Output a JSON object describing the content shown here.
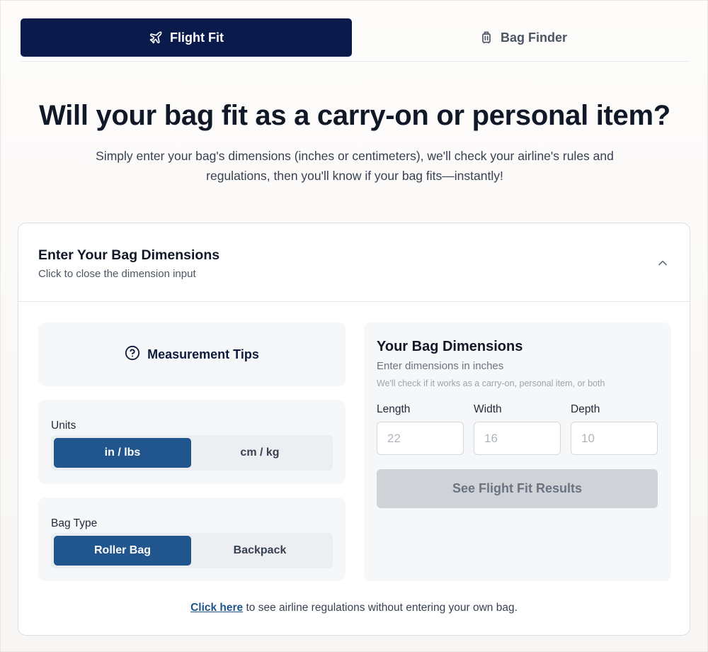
{
  "tabs": [
    {
      "label": "Flight Fit",
      "icon": "plane-icon",
      "active": true
    },
    {
      "label": "Bag Finder",
      "icon": "luggage-icon",
      "active": false
    }
  ],
  "hero": {
    "title": "Will your bag fit as a carry-on or personal item?",
    "subtitle": "Simply enter your bag's dimensions (inches or centimeters), we'll check your airline's rules and regulations, then you'll know if your bag fits—instantly!"
  },
  "card": {
    "title": "Enter Your Bag Dimensions",
    "subtitle": "Click to close the dimension input",
    "collapse_icon": "chevron-up-icon"
  },
  "tips": {
    "label": "Measurement Tips",
    "icon": "question-circle-icon"
  },
  "units": {
    "label": "Units",
    "options": [
      "in / lbs",
      "cm / kg"
    ],
    "selected": "in / lbs"
  },
  "bag_type": {
    "label": "Bag Type",
    "options": [
      "Roller Bag",
      "Backpack"
    ],
    "selected": "Roller Bag"
  },
  "dimensions": {
    "title": "Your Bag Dimensions",
    "subtitle": "Enter dimensions in inches",
    "note": "We'll check if it works as a carry-on, personal item, or both",
    "fields": [
      {
        "label": "Length",
        "placeholder": "22",
        "value": ""
      },
      {
        "label": "Width",
        "placeholder": "16",
        "value": ""
      },
      {
        "label": "Depth",
        "placeholder": "10",
        "value": ""
      }
    ],
    "submit_label": "See Flight Fit Results"
  },
  "footer": {
    "link_text": "Click here",
    "rest_text": " to see airline regulations without entering your own bag."
  },
  "colors": {
    "primary_navy": "#0a1a4a",
    "accent_blue": "#20558e",
    "disabled_button": "#cfd3d8"
  }
}
